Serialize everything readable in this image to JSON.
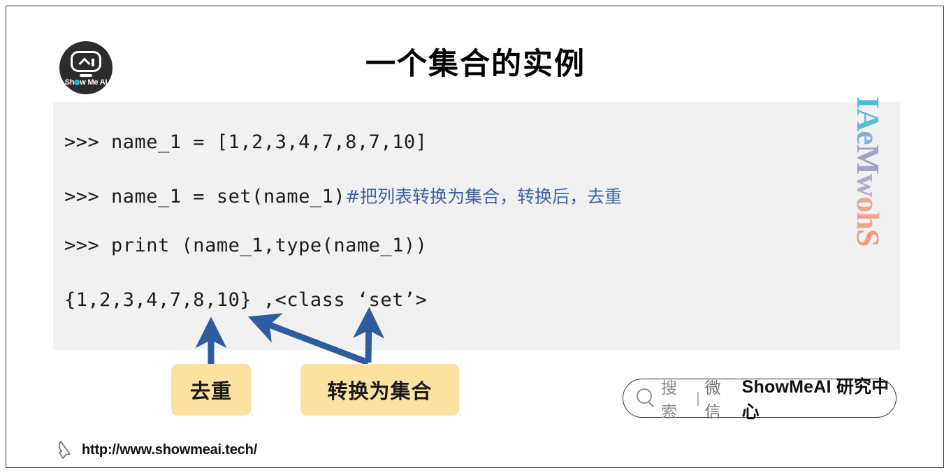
{
  "slide": {
    "title": "一个集合的实例",
    "logo": {
      "name": "showmeai-logo",
      "text_before": "Sh",
      "text_after": "w Me AI"
    },
    "watermark": {
      "text": "ShowMeAI",
      "letters": [
        "S",
        "h",
        "o",
        "w",
        "M",
        "e",
        "A",
        "I"
      ],
      "colors": [
        "#ef9274",
        "#ee9f83",
        "#e4a58f",
        "#b1a3c6",
        "#9a9bc9",
        "#7fa9d6",
        "#4cb8dd",
        "#29bcdc"
      ]
    }
  },
  "code": {
    "background": "#f1f1f1",
    "text_color": "#1c1c1c",
    "comment_color": "#3f63a5",
    "lines": [
      {
        "code": ">>> name_1 = [1,2,3,4,7,8,7,10]",
        "comment": ""
      },
      {
        "code": ">>> name_1 = set(name_1)",
        "comment": "#把列表转换为集合，转换后，去重"
      },
      {
        "code": ">>> print (name_1,type(name_1))",
        "comment": ""
      },
      {
        "code": "{1,2,3,4,7,8,10} ,<class ‘set’>",
        "comment": ""
      }
    ]
  },
  "callouts": [
    {
      "label": "去重",
      "color": "#fbe2a0"
    },
    {
      "label": "转换为集合",
      "color": "#fbe2a0"
    }
  ],
  "arrows": {
    "color": "#2e5c9e",
    "count": 3
  },
  "badge": {
    "search_label": "搜索",
    "separator": "|",
    "channel_label": "微信",
    "brand": "ShowMeAI 研究中心"
  },
  "footer": {
    "url": "http://www.showmeai.tech/"
  }
}
